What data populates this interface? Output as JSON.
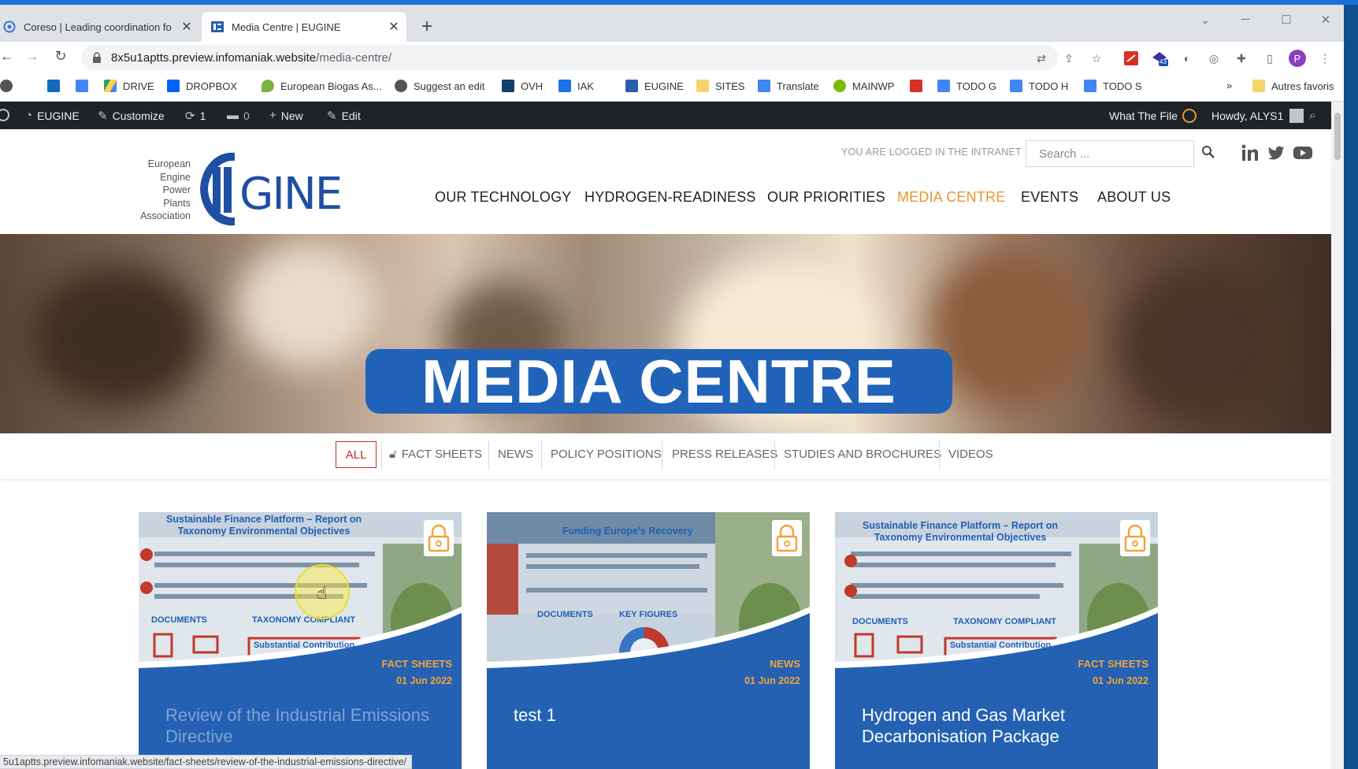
{
  "browser": {
    "tabs": [
      {
        "title": "Coreso | Leading coordination fo",
        "active": false
      },
      {
        "title": "Media Centre | EUGINE",
        "active": true
      }
    ],
    "new_tab": "+",
    "close": "✕",
    "window": {
      "minimize": "─",
      "maximize": "☐",
      "close": "✕",
      "tab_search": "⌄"
    },
    "url_host": "8x5u1aptts.preview.infomaniak.website",
    "url_path": "/media-centre/",
    "extension_badge": "43",
    "profile_initial": "P",
    "bookmarks": [
      {
        "label": "",
        "icon": "outlook-icon",
        "color": "#0f6cbd"
      },
      {
        "label": "",
        "icon": "docs-icon",
        "color": "#4285f4"
      },
      {
        "label": "DRIVE",
        "icon": "drive-icon",
        "color": "#1fa463"
      },
      {
        "label": "DROPBOX",
        "icon": "dropbox-icon",
        "color": "#0061fe"
      },
      {
        "label": "European Biogas As...",
        "icon": "biogas-icon",
        "color": "#7cb342"
      },
      {
        "label": "Suggest an edit",
        "icon": "globe-icon",
        "color": "#555555"
      },
      {
        "label": "OVH",
        "icon": "ovh-icon",
        "color": "#123f6d"
      },
      {
        "label": "IAK",
        "icon": "iak-icon",
        "color": "#1a73e8"
      },
      {
        "label": "EUGINE",
        "icon": "eugine-icon",
        "color": "#2a5db0"
      },
      {
        "label": "SITES",
        "icon": "folder-icon",
        "color": "#f6d36b"
      },
      {
        "label": "Translate",
        "icon": "translate-icon",
        "color": "#4285f4"
      },
      {
        "label": "MAINWP",
        "icon": "mainwp-icon",
        "color": "#7fb800"
      },
      {
        "label": "",
        "icon": "red-doc-icon",
        "color": "#d93025"
      },
      {
        "label": "TODO G",
        "icon": "docs-icon",
        "color": "#4285f4"
      },
      {
        "label": "TODO H",
        "icon": "docs-icon",
        "color": "#4285f4"
      },
      {
        "label": "TODO S",
        "icon": "docs-icon",
        "color": "#4285f4"
      }
    ],
    "more_bookmarks": "»",
    "other_bookmarks": "Autres favoris",
    "status_url": "5u1aptts.preview.infomaniak.website/fact-sheets/review-of-the-industrial-emissions-directive/"
  },
  "wp_admin": {
    "site_name": "EUGINE",
    "customize": "Customize",
    "updates": "1",
    "comments": "0",
    "new": "New",
    "edit": "Edit",
    "what_the_file": "What The File",
    "howdy": "Howdy, ALYS1"
  },
  "header": {
    "logo_words": [
      "European",
      "Engine",
      "Power",
      "Plants",
      "Association"
    ],
    "logo_mark": "GINE",
    "logged_in": "YOU ARE LOGGED IN THE INTRANET",
    "search_placeholder": "Search ...",
    "nav": [
      "OUR TECHNOLOGY",
      "HYDROGEN-READINESS",
      "OUR PRIORITIES",
      "MEDIA CENTRE",
      "EVENTS",
      "ABOUT US"
    ],
    "active_nav": "MEDIA CENTRE"
  },
  "hero": {
    "title": "MEDIA CENTRE"
  },
  "filters": {
    "all": "ALL",
    "items": [
      "FACT SHEETS",
      "NEWS",
      "POLICY POSITIONS",
      "PRESS RELEASES",
      "STUDIES AND BROCHURES",
      "VIDEOS"
    ]
  },
  "cards": [
    {
      "category": "FACT SHEETS",
      "date": "01 Jun 2022",
      "title": "Review of the Industrial Emissions Directive",
      "image_heading": "Sustainable Finance Platform – Report on Taxonomy Environmental Objectives",
      "image_labels": [
        "DOCUMENTS",
        "TAXONOMY COMPLIANT",
        "Substantial Contribution"
      ]
    },
    {
      "category": "NEWS",
      "date": "01 Jun 2022",
      "title": "test 1",
      "image_heading": "Funding Europe's Recovery",
      "image_labels": [
        "DOCUMENTS",
        "KEY FIGURES"
      ]
    },
    {
      "category": "FACT SHEETS",
      "date": "01 Jun 2022",
      "title": "Hydrogen and Gas Market Decarbonisation Package",
      "image_heading": "Sustainable Finance Platform – Report on Taxonomy Environmental Objectives",
      "image_labels": [
        "DOCUMENTS",
        "TAXONOMY COMPLIANT",
        "Substantial Contribution"
      ]
    }
  ],
  "colors": {
    "brand_blue": "#2163b8",
    "accent_orange": "#e8952f",
    "active_filter_red": "#c62d2d",
    "wp_bar": "#1d2327"
  }
}
